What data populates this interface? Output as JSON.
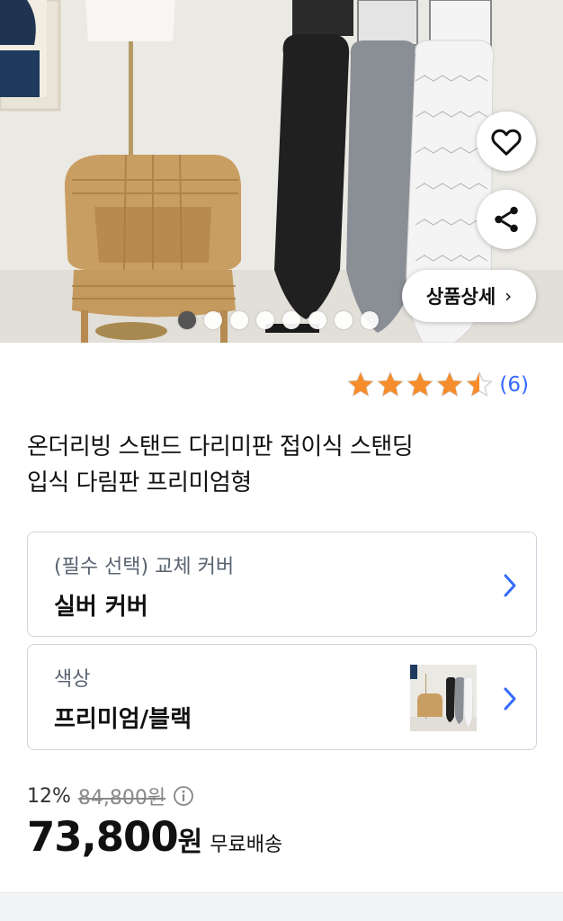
{
  "hero": {
    "carousel_total": 8,
    "carousel_active_index": 0,
    "detail_button_label": "상품상세",
    "detail_chevron": "›",
    "icons": [
      "heart-icon",
      "share-icon"
    ]
  },
  "rating": {
    "stars": 4.5,
    "review_count": "(6)",
    "star_color": "#f78d2a"
  },
  "product": {
    "title_line1": "온더리빙 스탠드 다리미판 접이식 스탠딩",
    "title_line2": "입식 다림판 프리미엄형"
  },
  "options": [
    {
      "label": "(필수 선택) 교체 커버",
      "value": "실버 커버"
    },
    {
      "label": "색상",
      "value": "프리미엄/블랙"
    }
  ],
  "price": {
    "discount_rate": "12%",
    "original_price": "84,800원",
    "sale_price": "73,800",
    "currency": "원",
    "shipping": "무료배송"
  },
  "colors": {
    "accent": "#346aff",
    "chevron": "#346aff"
  }
}
